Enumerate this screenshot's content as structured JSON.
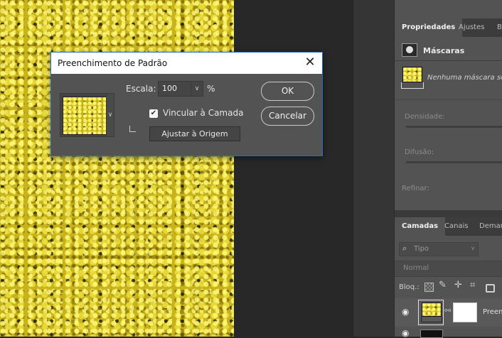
{
  "dialog": {
    "title": "Preenchimento de Padrão",
    "scale_label": "Escala:",
    "scale_value": "100",
    "scale_unit": "%",
    "link_label": "Vincular à Camada",
    "link_checked": true,
    "snap_button": "Ajustar à Origem",
    "ok_button": "OK",
    "cancel_button": "Cancelar"
  },
  "properties_panel": {
    "tabs": [
      "Propriedades",
      "Ajustes",
      "Bi"
    ],
    "section": "Máscaras",
    "mask_status": "Nenhuma máscara sele",
    "density_label": "Densidade:",
    "feather_label": "Difusão:",
    "refine_label": "Refinar:"
  },
  "layers_panel": {
    "tabs": [
      "Camadas",
      "Canais",
      "Demarc"
    ],
    "filter_placeholder": "Tipo",
    "blend_mode": "Normal",
    "lock_label": "Bloq.:",
    "layer_name": "Preenc"
  }
}
